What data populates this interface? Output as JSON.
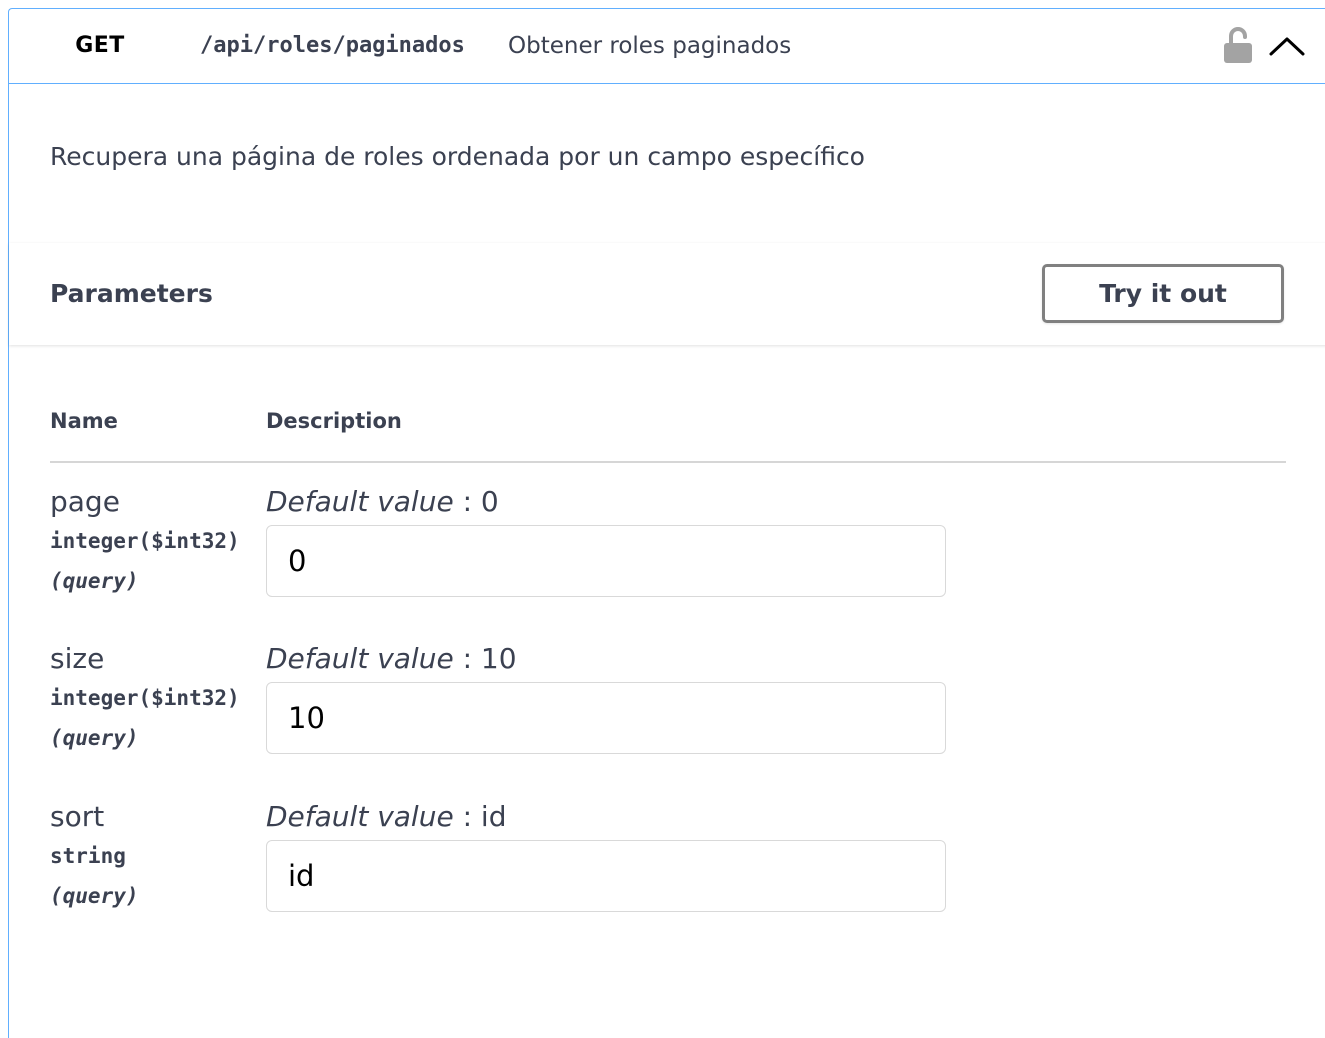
{
  "operation": {
    "method": "GET",
    "path": "/api/roles/paginados",
    "summary": "Obtener roles paginados",
    "description": "Recupera una página de roles ordenada por un campo específico",
    "method_color": "#61affe"
  },
  "parameters_section": {
    "title": "Parameters",
    "try_button_label": "Try it out",
    "columns": {
      "name": "Name",
      "description": "Description"
    }
  },
  "parameters": [
    {
      "name": "page",
      "type": "integer($int32)",
      "in": "(query)",
      "default_label": "Default value",
      "default_sep": " : ",
      "default_value": "0",
      "input_value": "0"
    },
    {
      "name": "size",
      "type": "integer($int32)",
      "in": "(query)",
      "default_label": "Default value",
      "default_sep": " : ",
      "default_value": "10",
      "input_value": "10"
    },
    {
      "name": "sort",
      "type": "string",
      "in": "(query)",
      "default_label": "Default value",
      "default_sep": " : ",
      "default_value": "id",
      "input_value": "id"
    }
  ],
  "icons": {
    "lock": "unlocked-padlock-icon",
    "toggle": "chevron-up-icon"
  }
}
